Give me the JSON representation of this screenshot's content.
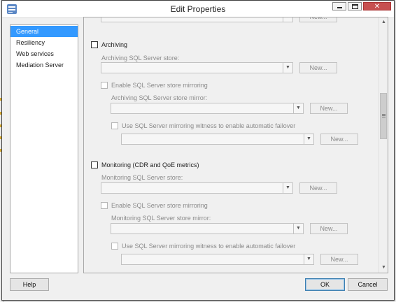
{
  "window": {
    "title": "Edit Properties"
  },
  "nav": {
    "items": [
      {
        "label": "General",
        "selected": true
      },
      {
        "label": "Resiliency"
      },
      {
        "label": "Web services"
      },
      {
        "label": "Mediation Server"
      }
    ]
  },
  "content": {
    "top_new_label": "New...",
    "archiving": {
      "checkbox_label": "Archiving",
      "store_label": "Archiving SQL Server store:",
      "new_label": "New...",
      "mirroring_label": "Enable SQL Server store mirroring",
      "mirror_store_label": "Archiving SQL Server store mirror:",
      "mirror_new_label": "New...",
      "witness_label": "Use SQL Server mirroring witness to enable automatic failover",
      "witness_new_label": "New..."
    },
    "monitoring": {
      "checkbox_label": "Monitoring (CDR and QoE metrics)",
      "store_label": "Monitoring SQL Server store:",
      "new_label": "New...",
      "mirroring_label": "Enable SQL Server store mirroring",
      "mirror_store_label": "Monitoring SQL Server store mirror:",
      "mirror_new_label": "New...",
      "witness_label": "Use SQL Server mirroring witness to enable automatic failover",
      "witness_new_label": "New..."
    }
  },
  "footer": {
    "help_label": "Help",
    "ok_label": "OK",
    "cancel_label": "Cancel"
  }
}
